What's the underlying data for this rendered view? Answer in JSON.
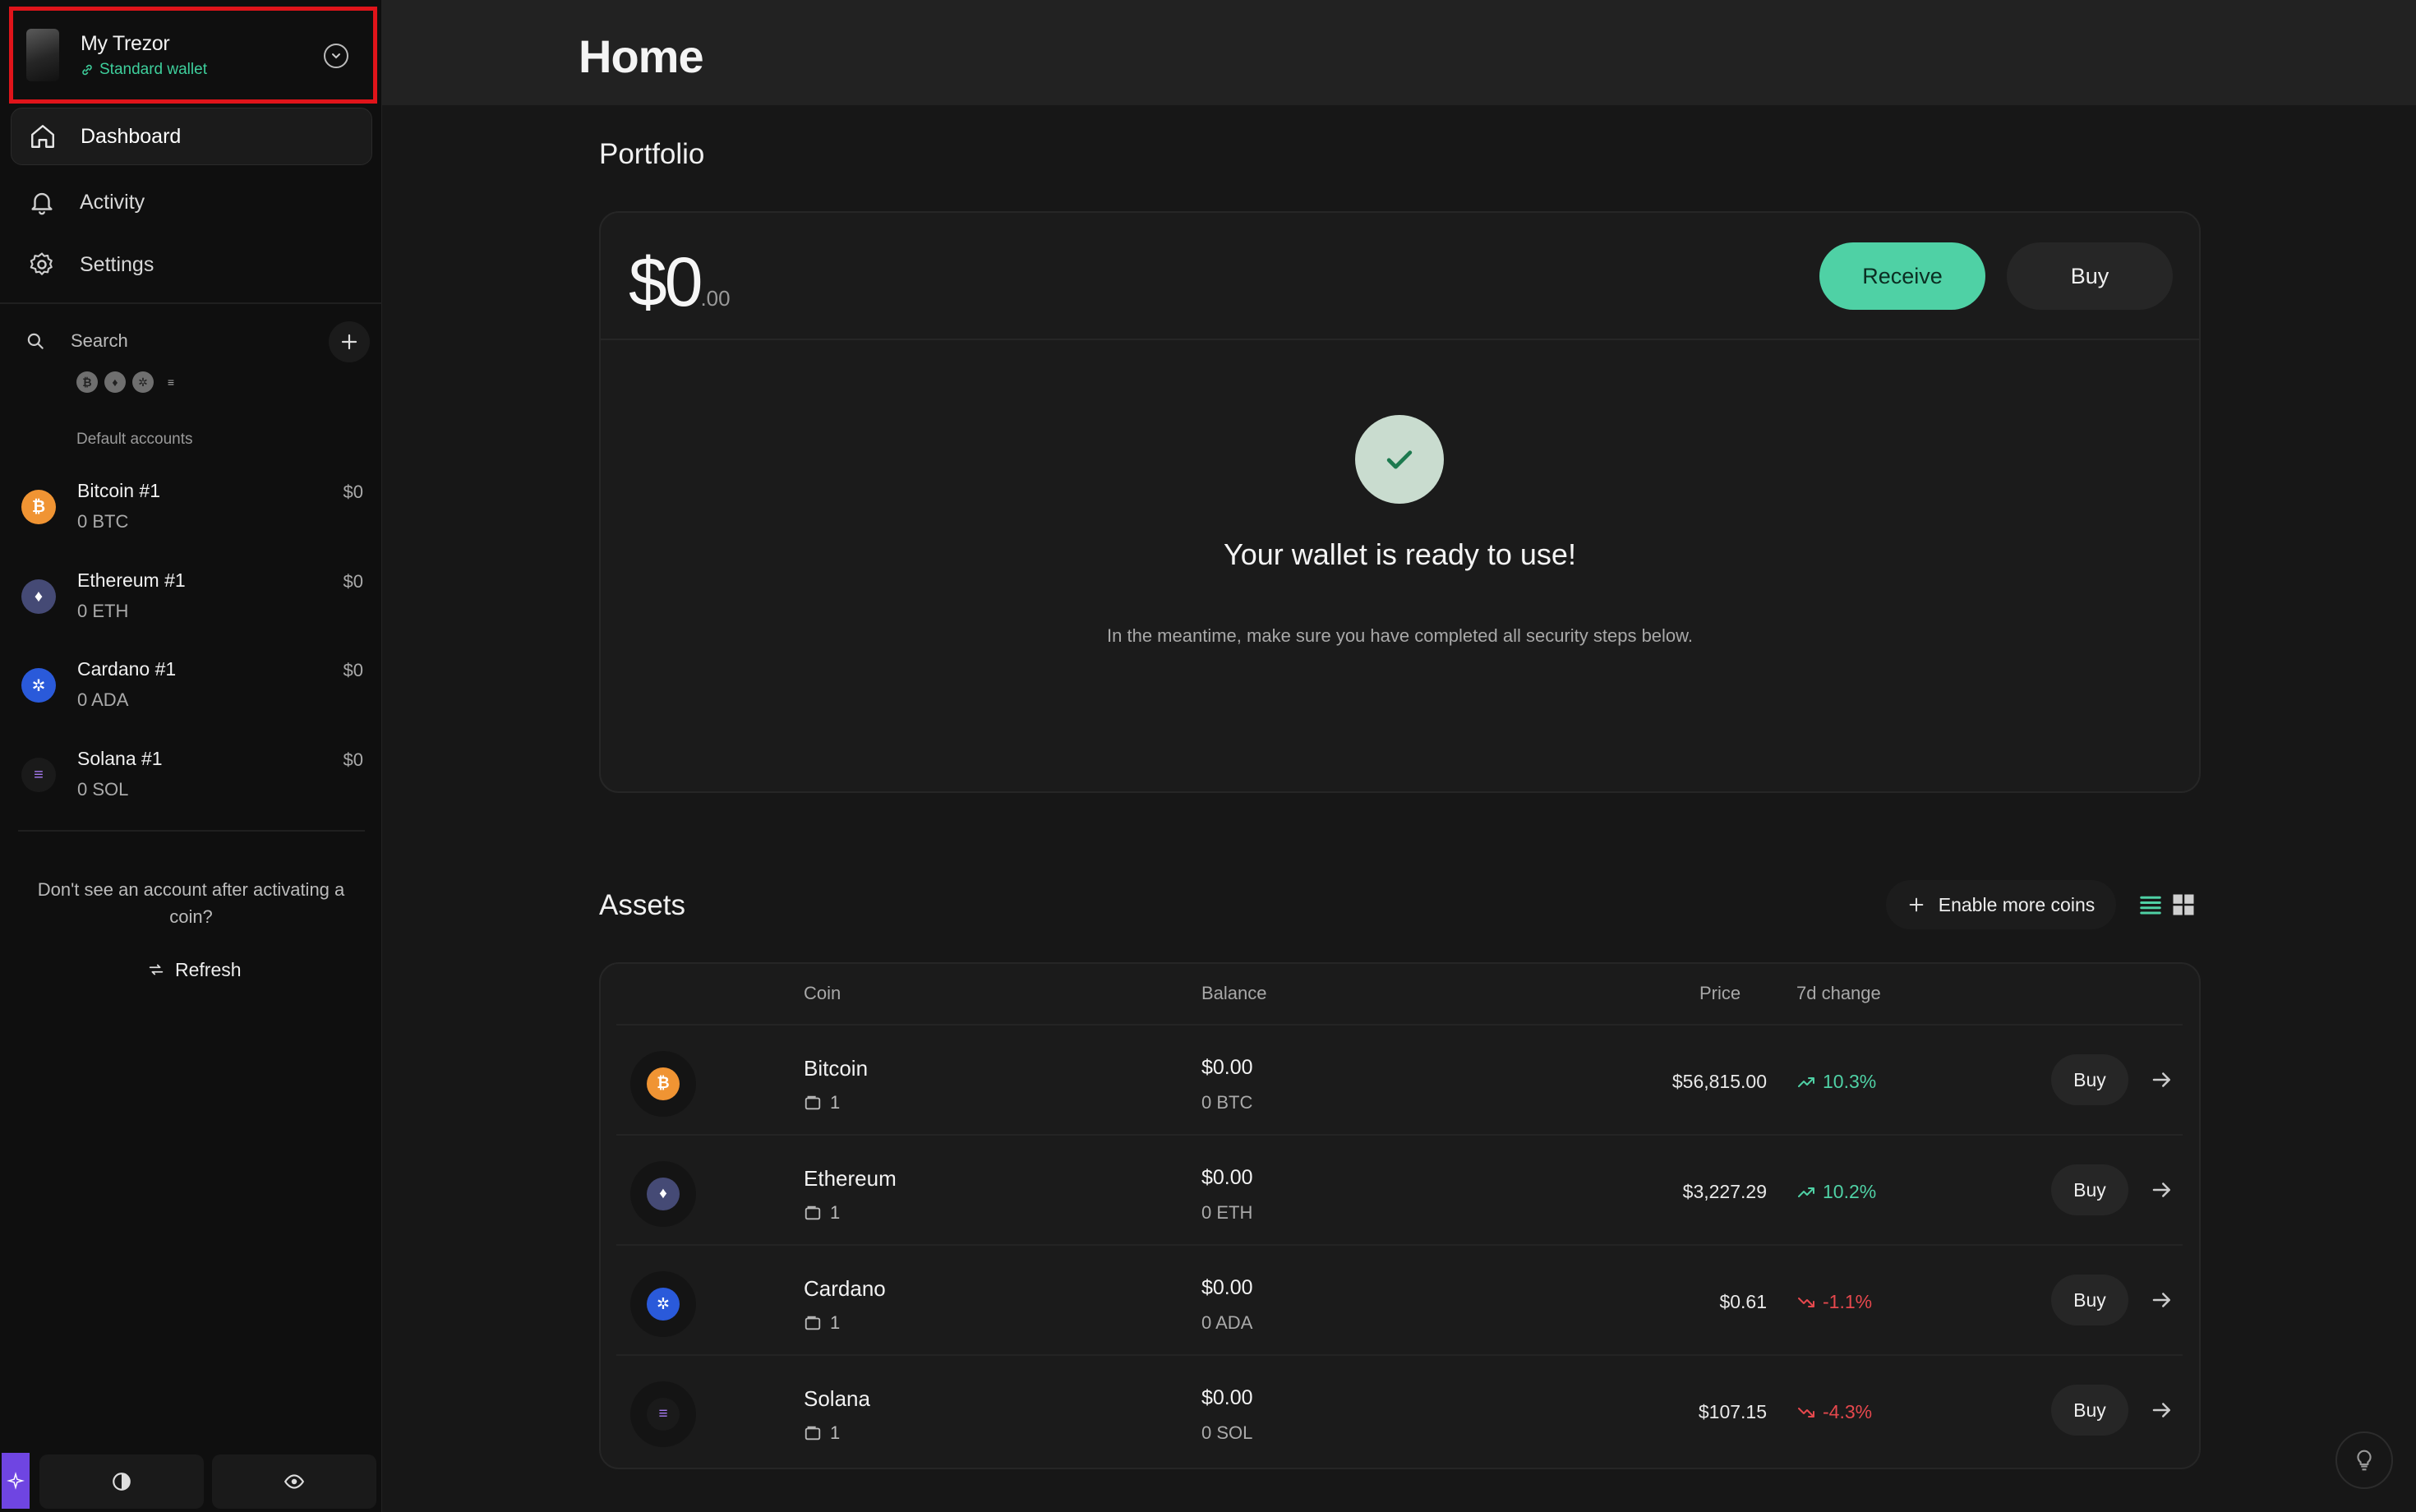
{
  "device": {
    "name": "My Trezor",
    "wallet_type": "Standard wallet"
  },
  "nav": [
    {
      "label": "Dashboard",
      "icon": "home-icon"
    },
    {
      "label": "Activity",
      "icon": "bell-icon"
    },
    {
      "label": "Settings",
      "icon": "gear-icon"
    }
  ],
  "search": {
    "label": "Search"
  },
  "filters": [
    "₿",
    "♦",
    "✲",
    "≡"
  ],
  "accounts_section": "Default accounts",
  "accounts": [
    {
      "name": "Bitcoin #1",
      "amount": "0 BTC",
      "fiat": "$0",
      "color": "#f09433",
      "glyph": "₿"
    },
    {
      "name": "Ethereum #1",
      "amount": "0 ETH",
      "fiat": "$0",
      "color": "#454a75",
      "glyph": "♦"
    },
    {
      "name": "Cardano #1",
      "amount": "0 ADA",
      "fiat": "$0",
      "color": "#2a5ada",
      "glyph": "✲"
    },
    {
      "name": "Solana #1",
      "amount": "0 SOL",
      "fiat": "$0",
      "color": "#1a1a1a",
      "glyph": "≡"
    }
  ],
  "hint": "Don't see an account after activating a coin?",
  "refresh_label": "Refresh",
  "page_title": "Home",
  "portfolio": {
    "heading": "Portfolio",
    "balance_main": "$0",
    "balance_cents": ".00",
    "receive_label": "Receive",
    "buy_label": "Buy",
    "ready_title": "Your wallet is ready to use!",
    "ready_sub": "In the meantime, make sure you have completed all security steps below."
  },
  "assets": {
    "heading": "Assets",
    "enable_label": "Enable more coins",
    "columns": {
      "coin": "Coin",
      "balance": "Balance",
      "price": "Price",
      "change": "7d change"
    },
    "rows": [
      {
        "name": "Bitcoin",
        "accounts": "1",
        "balance": "$0.00",
        "balance_sub": "0 BTC",
        "price": "$56,815.00",
        "change": "10.3%",
        "dir": "up",
        "color": "#f09433",
        "glyph": "₿",
        "buy": "Buy"
      },
      {
        "name": "Ethereum",
        "accounts": "1",
        "balance": "$0.00",
        "balance_sub": "0 ETH",
        "price": "$3,227.29",
        "change": "10.2%",
        "dir": "up",
        "color": "#454a75",
        "glyph": "♦",
        "buy": "Buy"
      },
      {
        "name": "Cardano",
        "accounts": "1",
        "balance": "$0.00",
        "balance_sub": "0 ADA",
        "price": "$0.61",
        "change": "-1.1%",
        "dir": "down",
        "color": "#2a5ada",
        "glyph": "✲",
        "buy": "Buy"
      },
      {
        "name": "Solana",
        "accounts": "1",
        "balance": "$0.00",
        "balance_sub": "0 SOL",
        "price": "$107.15",
        "change": "-4.3%",
        "dir": "down",
        "color": "#1a1a1a",
        "glyph": "≡",
        "buy": "Buy"
      }
    ]
  },
  "colors": {
    "accent": "#4fd1a5",
    "negative": "#e5484d",
    "highlight_box": "#e0141a"
  }
}
